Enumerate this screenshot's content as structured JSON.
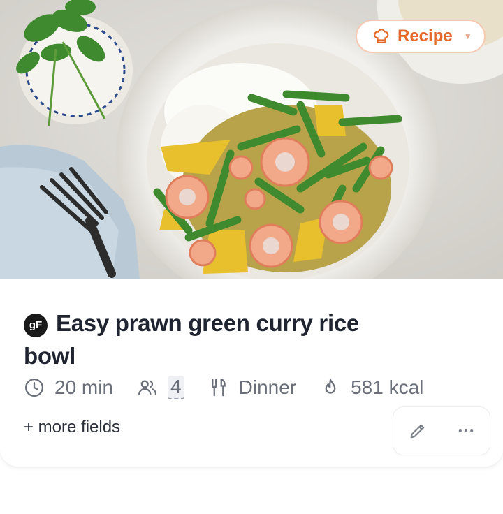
{
  "card": {
    "badge": {
      "label": "Recipe",
      "icon": "chef-hat-icon"
    },
    "source": {
      "logo_text": "gF"
    },
    "title": "Easy prawn green curry rice bowl",
    "meta": {
      "time": {
        "icon": "clock-icon",
        "value": "20 min"
      },
      "servings": {
        "icon": "people-icon",
        "value": "4"
      },
      "meal": {
        "icon": "fork-knife-icon",
        "value": "Dinner"
      },
      "calories": {
        "icon": "flame-icon",
        "value": "581 kcal"
      }
    },
    "more_fields": "+ more fields",
    "actions": {
      "edit_icon": "pencil-icon",
      "more_icon": "ellipsis-icon"
    }
  },
  "colors": {
    "accent": "#e46a2b",
    "accent_border": "#f6c9b3",
    "text": "#1f2430",
    "muted": "#6a6f7a"
  }
}
